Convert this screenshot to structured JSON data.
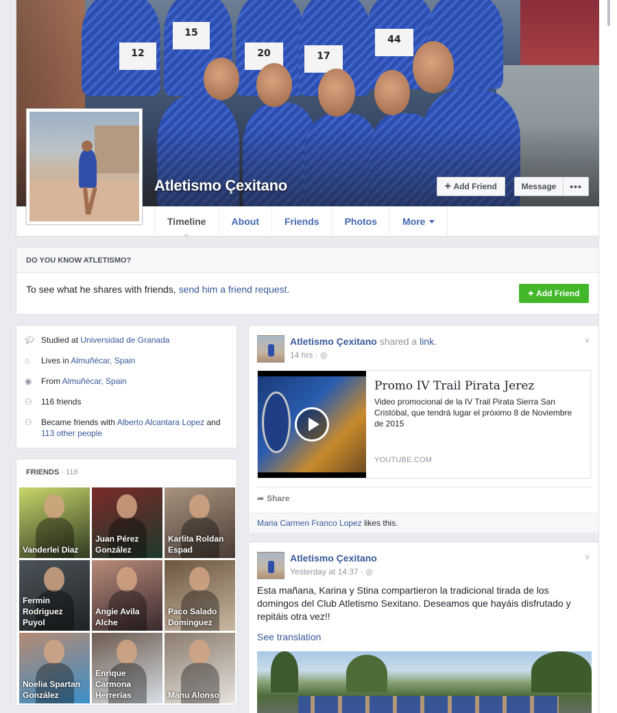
{
  "profile": {
    "name": "Atletismo Çexitano",
    "add_friend_label": "Add Friend",
    "message_label": "Message",
    "more_dots": "•••"
  },
  "tabs": [
    {
      "label": "Timeline"
    },
    {
      "label": "About"
    },
    {
      "label": "Friends"
    },
    {
      "label": "Photos"
    },
    {
      "label": "More"
    }
  ],
  "cover_bibs": [
    "12",
    "15",
    "20",
    "17",
    "44"
  ],
  "know": {
    "heading": "DO YOU KNOW ATLETISMO?",
    "text": "To see what he shares with friends, ",
    "link": "send him a friend request.",
    "button": "Add Friend"
  },
  "intro": {
    "studied_prefix": "Studied at ",
    "studied_link": "Universidad de Granada",
    "lives_prefix": "Lives in ",
    "lives_link": "Almuñécar, Spain",
    "from_prefix": "From ",
    "from_link": "Almuñécar, Spain",
    "friends_count_text": "116 friends",
    "became_prefix": "Became friends with ",
    "became_link1": "Alberto Alcantara Lopez",
    "became_mid": " and ",
    "became_link2": "113 other people"
  },
  "friends": {
    "heading": "FRIENDS",
    "count": " · 116",
    "items": [
      {
        "name": "Vanderlei Diaz",
        "c1": "#2f3a22",
        "c2": "#c9d66a"
      },
      {
        "name": "Juan Pérez González",
        "c1": "#1d3a2a",
        "c2": "#7a2a2a"
      },
      {
        "name": "Karlita Roldan Espad",
        "c1": "#4a3c35",
        "c2": "#a8937f"
      },
      {
        "name": "Fermin Rodriguez Puyol",
        "c1": "#1e2224",
        "c2": "#4c5459"
      },
      {
        "name": "Angie Avila Alche",
        "c1": "#3a2a2e",
        "c2": "#b98a7a"
      },
      {
        "name": "Paco Salado Dominguez",
        "c1": "#c9b8a2",
        "c2": "#6b5540"
      },
      {
        "name": "Noelia Spartan González",
        "c1": "#3b8fc9",
        "c2": "#b68a72"
      },
      {
        "name": "Enrique Carmona Herrerías",
        "c1": "#d7dfe6",
        "c2": "#6c5a4e"
      },
      {
        "name": "Manu Alonso",
        "c1": "#e7e3de",
        "c2": "#8a7b6c"
      }
    ]
  },
  "post1": {
    "author": "Atletismo Çexitano",
    "shared_text": " shared a ",
    "shared_link": "link.",
    "time": "14 hrs · ",
    "link_title": "Promo IV Trail Pirata Jerez",
    "link_desc": "Video promocional de la IV Trail Pirata Sierra San Cristóbal, que tendrá lugar el próximo 8 de Noviembre de 2015",
    "link_source": "YOUTUBE.COM",
    "share_label": "Share",
    "liker": "Maria Carmen Franco Lopez",
    "likes_suffix": " likes this."
  },
  "post2": {
    "author": "Atletismo Çexitano",
    "time": "Yesterday at 14:37 · ",
    "text": "Esta mañana, Karina y Stina compartieron la tradicional tirada de los domingos del Club Atletismo Sexitano. Deseamos que hayáis disfrutado y repitáis otra vez!!",
    "see_translation": "See translation"
  },
  "icons": {
    "globe": "globe-icon",
    "chevron": "chevron-down-icon",
    "share": "share-icon"
  }
}
